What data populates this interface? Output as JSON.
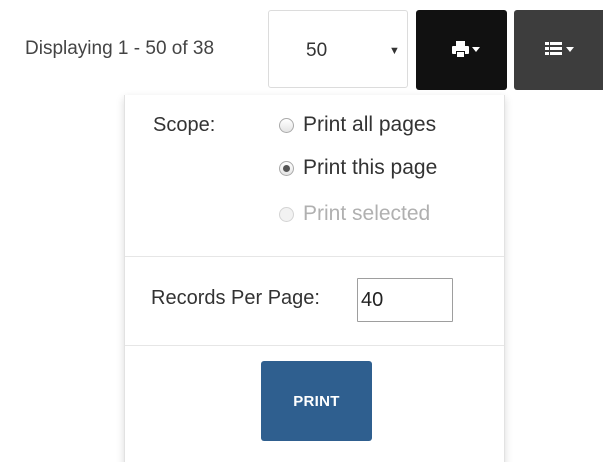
{
  "toolbar": {
    "display_text": "Displaying 1 - 50 of 38",
    "page_size": {
      "selected": "50"
    },
    "print_menu_icon": "printer-icon",
    "columns_menu_icon": "list-icon"
  },
  "print_panel": {
    "scope_label": "Scope:",
    "options": [
      {
        "label": "Print all pages",
        "checked": false,
        "disabled": false
      },
      {
        "label": "Print this page",
        "checked": true,
        "disabled": false
      },
      {
        "label": "Print selected",
        "checked": false,
        "disabled": true
      }
    ],
    "records_per_page_label": "Records Per Page:",
    "records_per_page_value": "40",
    "print_button_label": "PRINT"
  },
  "colors": {
    "print_button": "#2f5f8f",
    "print_menu_button": "#111111",
    "columns_menu_button": "#3d3d3d"
  }
}
